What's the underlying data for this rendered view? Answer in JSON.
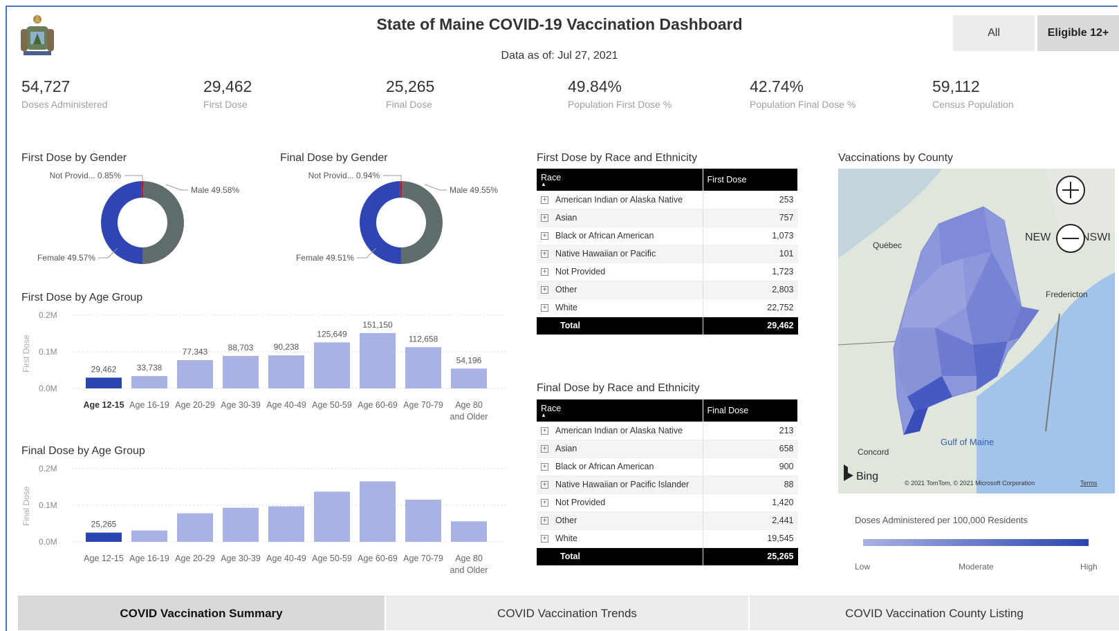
{
  "header": {
    "title": "State of Maine COVID-19 Vaccination Dashboard",
    "data_as_of": "Data as of: Jul 27, 2021",
    "toggle_all": "All",
    "toggle_eligible": "Eligible 12+"
  },
  "kpis": [
    {
      "value": "54,727",
      "label": "Doses Administered"
    },
    {
      "value": "29,462",
      "label": "First Dose"
    },
    {
      "value": "25,265",
      "label": "Final Dose"
    },
    {
      "value": "49.84%",
      "label": "Population First Dose %"
    },
    {
      "value": "42.74%",
      "label": "Population Final Dose %"
    },
    {
      "value": "59,112",
      "label": "Census Population"
    }
  ],
  "first_gender": {
    "title": "First Dose by Gender",
    "not_provided": "Not Provid... 0.85%",
    "male": "Male 49.58%",
    "female": "Female 49.57%"
  },
  "final_gender": {
    "title": "Final Dose by Gender",
    "not_provided": "Not Provid... 0.94%",
    "male": "Male 49.55%",
    "female": "Female 49.51%"
  },
  "first_age": {
    "title": "First Dose by Age Group",
    "y_axis_label": "First Dose"
  },
  "final_age": {
    "title": "Final Dose by Age Group",
    "y_axis_label": "Final Dose"
  },
  "first_race": {
    "title": "First Dose by Race and Ethnicity",
    "col_race": "Race",
    "col_value": "First Dose",
    "rows": [
      {
        "race": "American Indian or Alaska Native",
        "value": "253"
      },
      {
        "race": "Asian",
        "value": "757"
      },
      {
        "race": "Black or African American",
        "value": "1,073"
      },
      {
        "race": "Native Hawaiian or Pacific",
        "value": "101"
      },
      {
        "race": "Not Provided",
        "value": "1,723"
      },
      {
        "race": "Other",
        "value": "2,803"
      },
      {
        "race": "White",
        "value": "22,752"
      }
    ],
    "total_label": "Total",
    "total_value": "29,462"
  },
  "final_race": {
    "title": "Final Dose by Race and Ethnicity",
    "col_race": "Race",
    "col_value": "Final Dose",
    "rows": [
      {
        "race": "American Indian or Alaska Native",
        "value": "213"
      },
      {
        "race": "Asian",
        "value": "658"
      },
      {
        "race": "Black or African American",
        "value": "900"
      },
      {
        "race": "Native Hawaiian or Pacific Islander",
        "value": "88"
      },
      {
        "race": "Not Provided",
        "value": "1,420"
      },
      {
        "race": "Other",
        "value": "2,441"
      },
      {
        "race": "White",
        "value": "19,545"
      }
    ],
    "total_label": "Total",
    "total_value": "25,265"
  },
  "map": {
    "title": "Vaccinations by County",
    "labels": {
      "quebec": "Québec",
      "new": "NEW",
      "nswi": "NSWI",
      "fredericton": "Fredericton",
      "gulf": "Gulf of Maine",
      "concord": "Concord",
      "bing": "Bing",
      "copyright": "© 2021 TomTom, © 2021 Microsoft Corporation",
      "terms": "Terms"
    },
    "legend_title": "Doses Administered per 100,000 Residents",
    "legend_low": "Low",
    "legend_mid": "Moderate",
    "legend_high": "High",
    "legend_color_low": "#a9b2e3",
    "legend_color_high": "#2b45b0"
  },
  "tabs": [
    {
      "label": "COVID Vaccination Summary"
    },
    {
      "label": "COVID Vaccination Trends"
    },
    {
      "label": "COVID Vaccination County Listing"
    }
  ],
  "chart_data": [
    {
      "type": "pie",
      "title": "First Dose by Gender",
      "categories": [
        "Male",
        "Female",
        "Not Provided"
      ],
      "values": [
        49.58,
        49.57,
        0.85
      ],
      "colors": [
        "#5f6b6d",
        "#2f45b3",
        "#b4202a"
      ]
    },
    {
      "type": "pie",
      "title": "Final Dose by Gender",
      "categories": [
        "Male",
        "Female",
        "Not Provided"
      ],
      "values": [
        49.55,
        49.51,
        0.94
      ],
      "colors": [
        "#5f6b6d",
        "#2f45b3",
        "#b4202a"
      ]
    },
    {
      "type": "bar",
      "title": "First Dose by Age Group",
      "ylabel": "First Dose",
      "categories": [
        "Age 12-15",
        "Age 16-19",
        "Age 20-29",
        "Age 30-39",
        "Age 40-49",
        "Age 50-59",
        "Age 60-69",
        "Age 70-79",
        "Age 80 and Older"
      ],
      "values": [
        29462,
        33738,
        77343,
        88703,
        90238,
        125649,
        151150,
        112658,
        54196
      ],
      "value_labels": [
        "29,462",
        "33,738",
        "77,343",
        "88,703",
        "90,238",
        "125,649",
        "151,150",
        "112,658",
        "54,196"
      ],
      "yticks": [
        "0.0M",
        "0.1M",
        "0.2M"
      ],
      "ylim": [
        0,
        200000
      ],
      "highlight_index": 0,
      "color": "#a9b2e3",
      "highlight_color": "#2b45b0"
    },
    {
      "type": "bar",
      "title": "Final Dose by Age Group",
      "ylabel": "Final Dose",
      "categories": [
        "Age 12-15",
        "Age 16-19",
        "Age 20-29",
        "Age 30-39",
        "Age 40-49",
        "Age 50-59",
        "Age 60-69",
        "Age 70-79",
        "Age 80 and Older"
      ],
      "values": [
        25265,
        31000,
        78000,
        93000,
        97000,
        137000,
        165000,
        115000,
        56000
      ],
      "value_labels": [
        "25,265",
        "",
        "",
        "",
        "",
        "",
        "",
        "",
        ""
      ],
      "yticks": [
        "0.0M",
        "0.1M",
        "0.2M"
      ],
      "ylim": [
        0,
        200000
      ],
      "highlight_index": 0,
      "color": "#a9b2e3",
      "highlight_color": "#2b45b0"
    }
  ]
}
